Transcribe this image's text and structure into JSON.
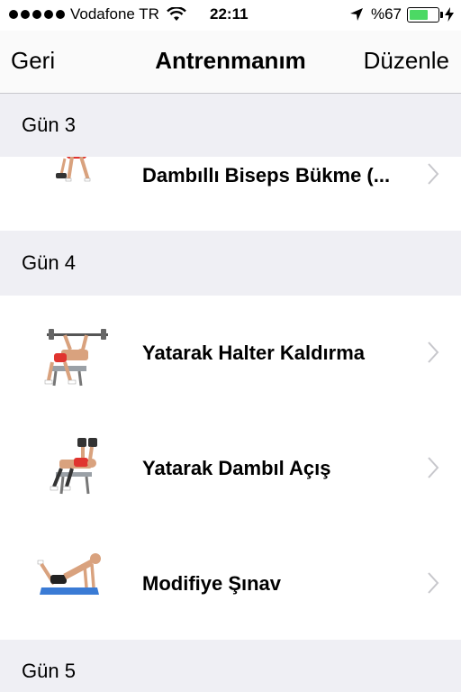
{
  "status_bar": {
    "carrier": "Vodafone TR",
    "time": "22:11",
    "battery": "%67",
    "battery_level": 0.67
  },
  "nav": {
    "back_label": "Geri",
    "title": "Antrenmanım",
    "edit_label": "Düzenle"
  },
  "sections": [
    {
      "header": "Gün 3",
      "items": [
        {
          "label": "Dambıllı Biseps Bükme (...",
          "icon": "bent-over-dumbbell-curl-thumbnail"
        }
      ]
    },
    {
      "header": "Gün 4",
      "items": [
        {
          "label": "Yatarak Halter Kaldırma",
          "icon": "bench-press-thumbnail"
        },
        {
          "label": "Yatarak Dambıl Açış",
          "icon": "dumbbell-fly-thumbnail"
        },
        {
          "label": "Modifiye Şınav",
          "icon": "modified-pushup-thumbnail"
        }
      ]
    },
    {
      "header": "Gün 5",
      "items": []
    }
  ],
  "colors": {
    "section_bg": "#efeff4",
    "battery_green": "#4cd964",
    "chevron": "#c7c7cc",
    "shorts_red": "#e0342f",
    "mat_blue": "#3a7bd5"
  }
}
